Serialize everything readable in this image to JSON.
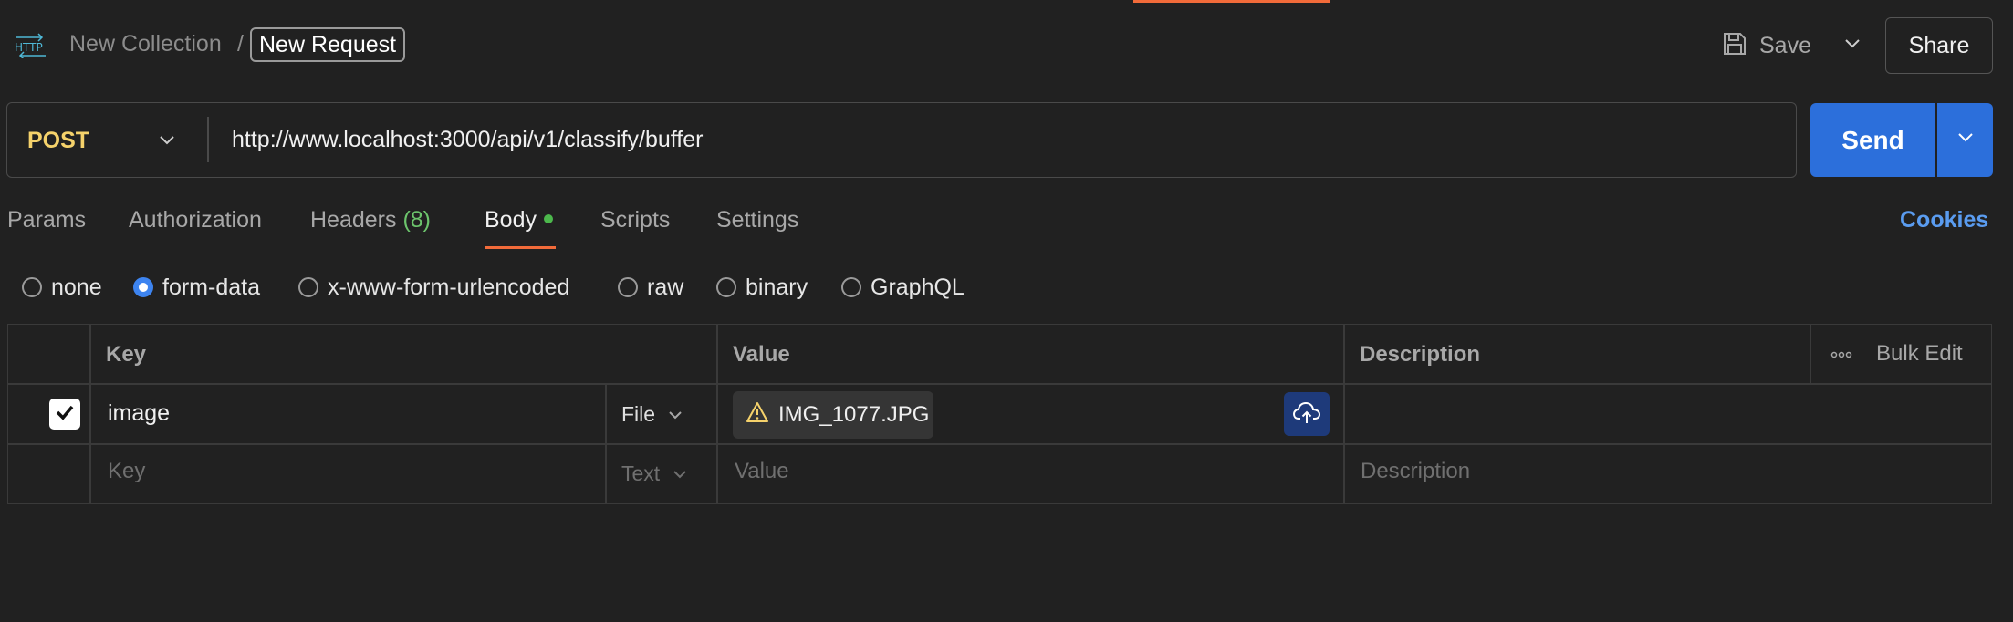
{
  "header": {
    "http_label": "HTTP",
    "collection": "New Collection",
    "separator": "/",
    "request_name": "New Request",
    "save_label": "Save",
    "share_label": "Share"
  },
  "request": {
    "method": "POST",
    "url": "http://www.localhost:3000/api/v1/classify/buffer",
    "send_label": "Send"
  },
  "tabs": {
    "params": "Params",
    "authorization": "Authorization",
    "headers": "Headers",
    "headers_count": "(8)",
    "body": "Body",
    "scripts": "Scripts",
    "settings": "Settings",
    "cookies": "Cookies"
  },
  "body_modes": {
    "none": "none",
    "form_data": "form-data",
    "urlencoded": "x-www-form-urlencoded",
    "raw": "raw",
    "binary": "binary",
    "graphql": "GraphQL",
    "selected": "form-data"
  },
  "table": {
    "headers": {
      "key": "Key",
      "value": "Value",
      "description": "Description",
      "bulk_edit": "Bulk Edit"
    },
    "rows": [
      {
        "checked": true,
        "key": "image",
        "type": "File",
        "value": "IMG_1077.JPG",
        "description": ""
      }
    ],
    "new_row": {
      "key_placeholder": "Key",
      "type": "Text",
      "value_placeholder": "Value",
      "description_placeholder": "Description"
    }
  },
  "colors": {
    "accent_orange": "#f26b3a",
    "send_blue": "#2c6fdb",
    "method_yellow": "#f5d26b",
    "cookies_blue": "#5a9cf0",
    "count_green": "#6cc46c"
  },
  "icons": [
    "http-icon",
    "save-icon",
    "chevron-down-icon",
    "warning-icon",
    "cloud-upload-icon",
    "more-icon",
    "check-icon"
  ]
}
